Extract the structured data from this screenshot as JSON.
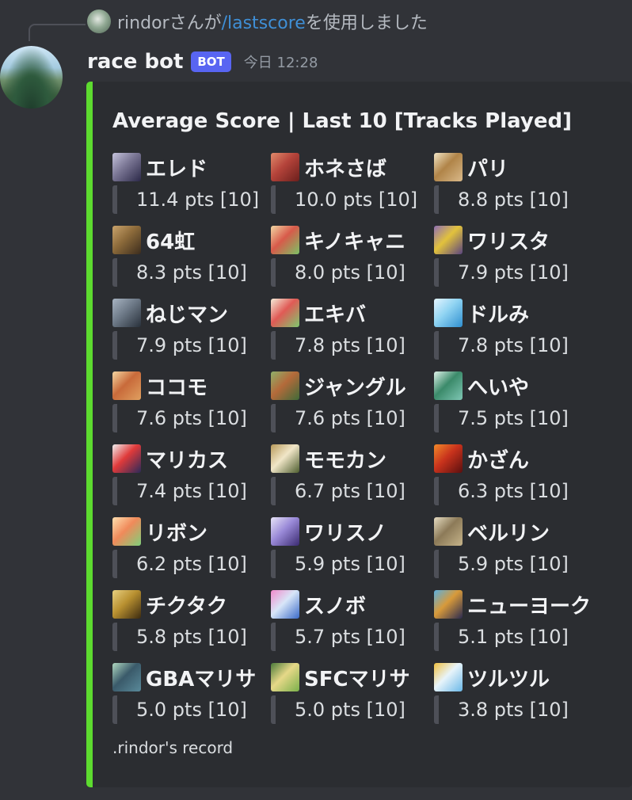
{
  "reply": {
    "user": "rindor",
    "text_before": "さんが",
    "command": "/lastscore",
    "text_after": "を使用しました"
  },
  "message": {
    "author": "race bot",
    "badge": "BOT",
    "timestamp": "今日 12:28"
  },
  "embed": {
    "accent_color": "#5ddb2f",
    "title": "Average Score | Last 10 [Tracks Played]",
    "footer": ".rindor's record",
    "fields": [
      {
        "name": "エレド",
        "value": "11.4 pts [10]",
        "icon_colors": [
          "#2b2848",
          "#7a7694",
          "#c5c3dc"
        ]
      },
      {
        "name": "ホネさば",
        "value": "10.0 pts [10]",
        "icon_colors": [
          "#6b1f1c",
          "#b4433a",
          "#e08a6b"
        ]
      },
      {
        "name": "パリ",
        "value": "8.8 pts [10]",
        "icon_colors": [
          "#d9b98a",
          "#b08448",
          "#f1e4c5"
        ]
      },
      {
        "name": "64虹",
        "value": "8.3 pts [10]",
        "icon_colors": [
          "#3b2c1d",
          "#8c6a3a",
          "#c9a36c"
        ]
      },
      {
        "name": "キノキャニ",
        "value": "8.0 pts [10]",
        "icon_colors": [
          "#7cc265",
          "#d85a4a",
          "#f1d7a4"
        ]
      },
      {
        "name": "ワリスタ",
        "value": "7.9 pts [10]",
        "icon_colors": [
          "#5a4480",
          "#e2c23c",
          "#8f6fb5"
        ]
      },
      {
        "name": "ねじマン",
        "value": "7.9 pts [10]",
        "icon_colors": [
          "#28303a",
          "#6e7a88",
          "#a8b4c2"
        ]
      },
      {
        "name": "エキバ",
        "value": "7.8 pts [10]",
        "icon_colors": [
          "#7fc86e",
          "#e05a55",
          "#f5ecd8"
        ]
      },
      {
        "name": "ドルみ",
        "value": "7.8 pts [10]",
        "icon_colors": [
          "#2f8fd0",
          "#8fd3f2",
          "#e5f5ff"
        ]
      },
      {
        "name": "ココモ",
        "value": "7.6 pts [10]",
        "icon_colors": [
          "#e0a060",
          "#c86a3a",
          "#f4d6a2"
        ]
      },
      {
        "name": "ジャングル",
        "value": "7.6 pts [10]",
        "icon_colors": [
          "#3f6b39",
          "#b46a3a",
          "#8fb06a"
        ]
      },
      {
        "name": "へいや",
        "value": "7.5 pts [10]",
        "icon_colors": [
          "#7fc7b4",
          "#3b8a6a",
          "#dff2ea"
        ]
      },
      {
        "name": "マリカス",
        "value": "7.4 pts [10]",
        "icon_colors": [
          "#2a2a5a",
          "#e03a3a",
          "#f0f0f0"
        ]
      },
      {
        "name": "モモカン",
        "value": "6.7 pts [10]",
        "icon_colors": [
          "#4d5d2e",
          "#f1e6c8",
          "#b89a5a"
        ]
      },
      {
        "name": "かざん",
        "value": "6.3 pts [10]",
        "icon_colors": [
          "#5a0f0f",
          "#c8321c",
          "#f28a2a"
        ]
      },
      {
        "name": "リボン",
        "value": "6.2 pts [10]",
        "icon_colors": [
          "#7fd07a",
          "#f08a5a",
          "#ffe0b0"
        ]
      },
      {
        "name": "ワリスノ",
        "value": "5.9 pts [10]",
        "icon_colors": [
          "#3a2a70",
          "#9a8ad8",
          "#e8e4f8"
        ]
      },
      {
        "name": "ベルリン",
        "value": "5.9 pts [10]",
        "icon_colors": [
          "#c6b48a",
          "#8c7a58",
          "#e6dcc2"
        ]
      },
      {
        "name": "チクタク",
        "value": "5.8 pts [10]",
        "icon_colors": [
          "#3b2a10",
          "#b89030",
          "#e8d080"
        ]
      },
      {
        "name": "スノボ",
        "value": "5.7 pts [10]",
        "icon_colors": [
          "#3a6ac8",
          "#d8e6f8",
          "#f28acb"
        ]
      },
      {
        "name": "ニューヨーク",
        "value": "5.1 pts [10]",
        "icon_colors": [
          "#2a2a50",
          "#d89a3a",
          "#5ab0e0"
        ]
      },
      {
        "name": "GBAマリサ",
        "value": "5.0 pts [10]",
        "icon_colors": [
          "#5a8a9a",
          "#3a5a6a",
          "#b0d8c0"
        ]
      },
      {
        "name": "SFCマリサ",
        "value": "5.0 pts [10]",
        "icon_colors": [
          "#7ab04a",
          "#e6d888",
          "#4a7a3a"
        ]
      },
      {
        "name": "ツルツル",
        "value": "3.8 pts [10]",
        "icon_colors": [
          "#6ab8e8",
          "#e8f4fa",
          "#f0c040"
        ]
      }
    ]
  }
}
